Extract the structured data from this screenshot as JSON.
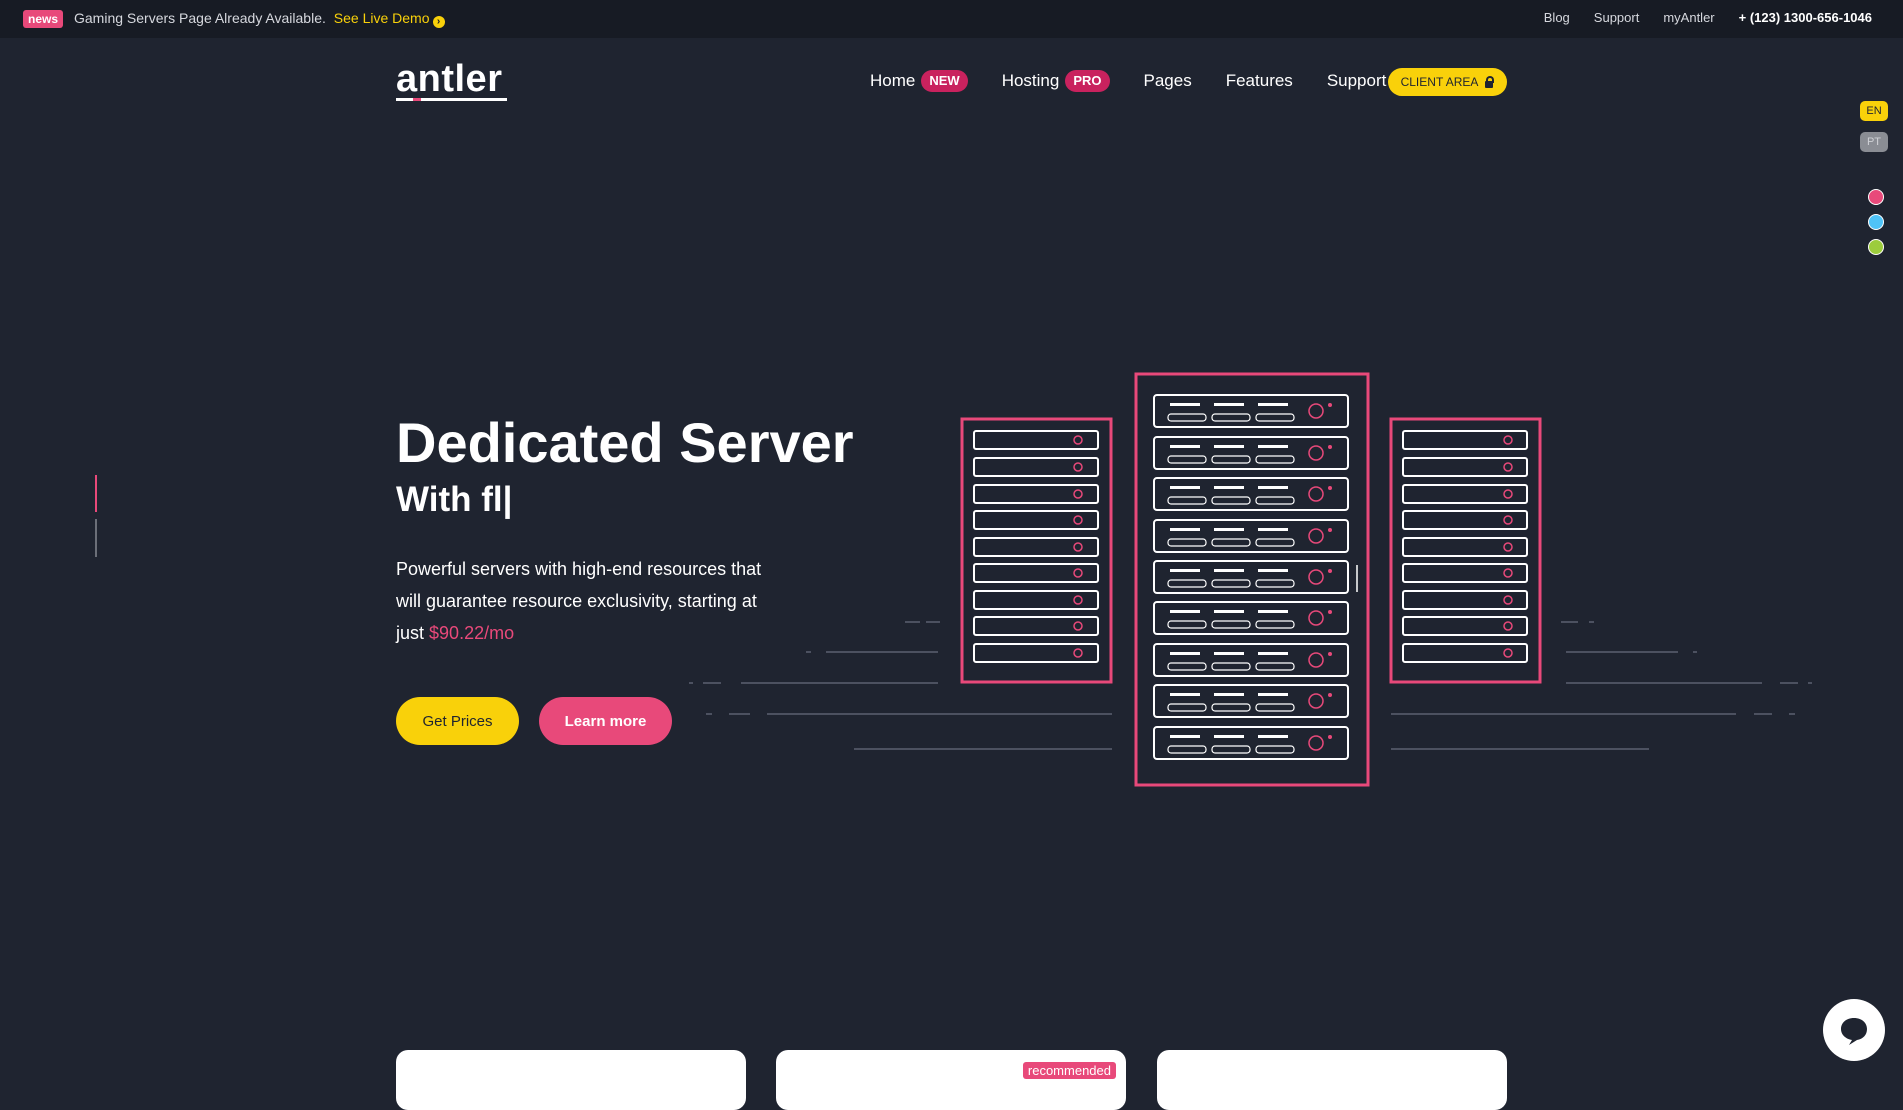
{
  "topbar": {
    "badge": "news",
    "message": "Gaming Servers Page Already Available.",
    "link": "See Live Demo",
    "links": [
      "Blog",
      "Support",
      "myAntler"
    ],
    "phone": "+ (123) 1300-656-1046"
  },
  "header": {
    "logo": "antler",
    "nav": [
      {
        "label": "Home",
        "badge": "NEW"
      },
      {
        "label": "Hosting",
        "badge": "PRO"
      },
      {
        "label": "Pages"
      },
      {
        "label": "Features"
      },
      {
        "label": "Support"
      }
    ],
    "client_area": "CLIENT AREA"
  },
  "languages": [
    "EN",
    "PT"
  ],
  "color_swatches": [
    "#e8497a",
    "#4fc3f7",
    "#9ccc3c"
  ],
  "hero": {
    "title": "Dedicated Server",
    "subtitle": "With fl|",
    "description": "Powerful servers with high-end resources that will guarantee resource exclusivity, starting at just",
    "price": "$90.22/mo",
    "buttons": {
      "primary": "Get Prices",
      "secondary": "Learn more"
    }
  },
  "cards": {
    "recommended": "recommended"
  },
  "colors": {
    "background": "#1f2430",
    "topbar": "#171b24",
    "accent_pink": "#e8497a",
    "accent_yellow": "#f9d10a",
    "badge": "#c9225e"
  },
  "icons": [
    "arrow-right-circle-icon",
    "lock-icon",
    "chat-icon",
    "server-rack-illustration"
  ]
}
